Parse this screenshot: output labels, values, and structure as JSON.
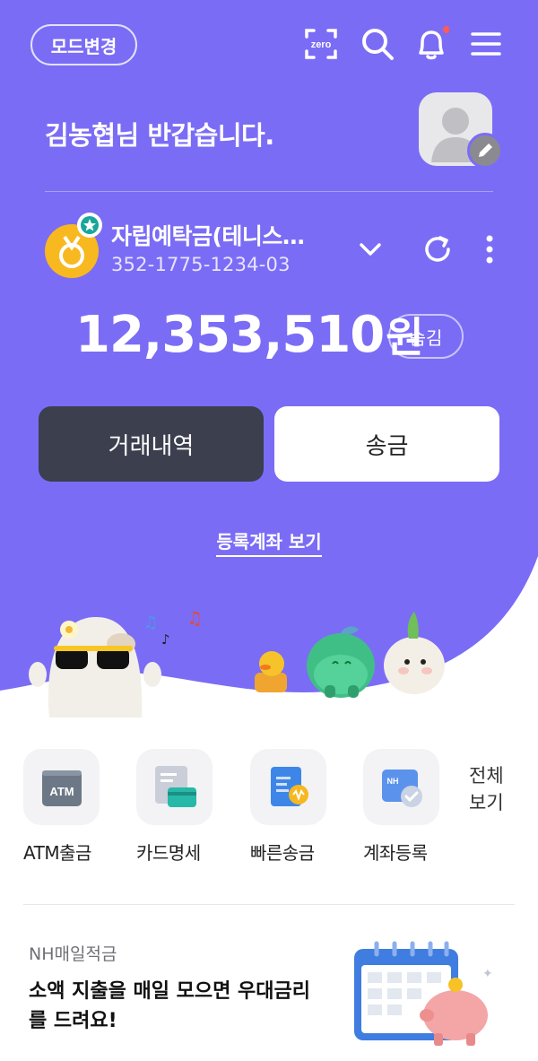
{
  "header": {
    "mode_button": "모드변경",
    "icons": [
      "zero-pay-icon",
      "search-icon",
      "bell-icon",
      "menu-icon"
    ],
    "zero_label": "zero",
    "notification_dot": true
  },
  "greeting": "김농협님 반갑습니다.",
  "account": {
    "name": "자립예탁금(테니스…",
    "number": "352-1775-1234-03",
    "balance": "12,353,510",
    "currency": "원",
    "hide_label": "숨김"
  },
  "actions": {
    "history": "거래내역",
    "transfer": "송금"
  },
  "registered_link": "등록계좌 보기",
  "quick_menu": [
    {
      "label": "ATM출금",
      "icon": "atm-icon",
      "icon_text": "ATM"
    },
    {
      "label": "카드명세",
      "icon": "card-statement-icon"
    },
    {
      "label": "빠른송금",
      "icon": "quick-transfer-icon"
    },
    {
      "label": "계좌등록",
      "icon": "account-register-icon",
      "icon_text": "NH"
    }
  ],
  "quick_all": "전체 보기",
  "promo": {
    "subtitle": "NH매일적금",
    "title": "소액 지출을 매일 모으면 우대금리를 드려요!"
  },
  "colors": {
    "brand": "#7b6cf6",
    "dark_button": "#3b3f4e",
    "badge": "#f8b81f",
    "star": "#1aa59a"
  }
}
